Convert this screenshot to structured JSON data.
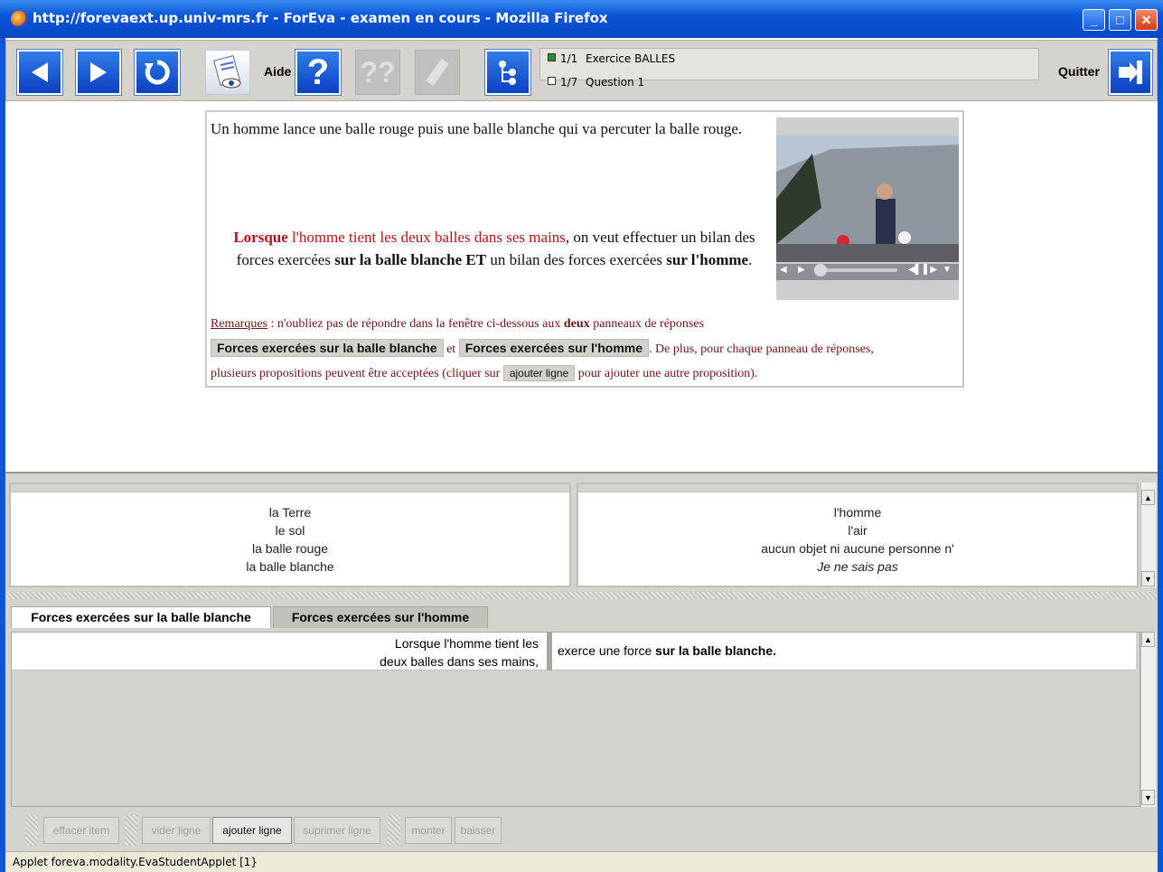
{
  "window": {
    "title": "http://forevaext.up.univ-mrs.fr - ForEva - examen en cours - Mozilla Firefox",
    "minimize_label": "_",
    "maximize_label": "□",
    "close_label": "✕"
  },
  "toolbar": {
    "aide_label": "Aide",
    "quit_label": "Quitter",
    "info": {
      "exercise_counter": "1/1",
      "exercise_name": "Exercice BALLES",
      "question_counter": "1/7",
      "question_name": "Question 1"
    }
  },
  "question": {
    "intro": "Un homme lance une balle rouge puis une balle blanche qui va percuter la balle rouge.",
    "p_lorsque": "Lorsque",
    "p_red": " l'homme tient les deux balles dans ses mains",
    "p_mid1": ", on veut effectuer un bilan des forces exercées ",
    "p_bold1": "sur la balle blanche ET",
    "p_mid2": " un bilan des forces exercées ",
    "p_bold2": "sur l'homme",
    "p_end": ".",
    "remarques_label": "Remarques",
    "remarques_text": " : n'oubliez pas de répondre dans la fenêtre ci-dessous aux ",
    "remarques_bold": "deux",
    "remarques_text2": " panneaux de réponses",
    "pill1": "Forces exercées sur la balle blanche",
    "et": "et",
    "pill2": "Forces exercées sur l'homme",
    "de_plus": ". De plus, pour chaque panneau de réponses,",
    "plusieurs": "plusieurs propositions peuvent être acceptées (cliquer sur",
    "pill3": "ajouter ligne",
    "pour_ajouter": "pour ajouter une autre proposition)."
  },
  "lists": {
    "left": [
      "la Terre",
      "le sol",
      "la balle rouge",
      "la balle blanche"
    ],
    "right": [
      "l'homme",
      "l'air",
      "aucun objet ni aucune personne n'",
      "Je ne sais pas"
    ]
  },
  "tabs": [
    {
      "label": "Forces exercées sur la balle blanche",
      "active": true
    },
    {
      "label": "Forces exercées sur l'homme",
      "active": false
    }
  ],
  "answer_row": {
    "left_line1": "Lorsque l'homme tient les",
    "left_line2": "deux balles dans ses mains,",
    "right_text": "exerce une force ",
    "right_bold": "sur la balle blanche."
  },
  "buttons": {
    "effacer_item": "effacer item",
    "vider_ligne": "vider ligne",
    "ajouter_ligne": "ajouter ligne",
    "suprimer_ligne": "suprimer ligne",
    "monter": "monter",
    "baisser": "baisser"
  },
  "status_bar": "Applet foreva.modality.EvaStudentApplet [1}",
  "colors": {
    "title_blue": "#0a55d8",
    "accent_red": "#b0151a",
    "panel_gray": "#d6d3ce"
  }
}
